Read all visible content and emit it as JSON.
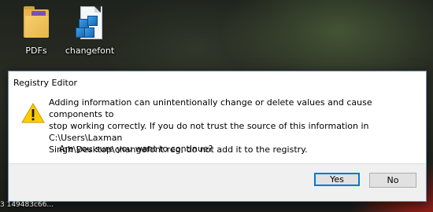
{
  "desktop": {
    "icons": [
      {
        "label": "PDFs",
        "icon": "folder-icon"
      },
      {
        "label": "changefont",
        "icon": "registry-file-icon"
      }
    ],
    "bottom_text": "3  149483c66..."
  },
  "dialog": {
    "title": "Registry Editor",
    "icon": "warning-icon",
    "accent_color": "#0078d7",
    "warning_color": "#ffcc00",
    "message": "Adding information can unintentionally change or delete values and cause components to\nstop working correctly. If you do not trust the source of this information in C:\\Users\\Laxman\nSingh\\Desktop\\changefont.reg, do not add it to the registry.",
    "question": "Are you sure you want to continue?",
    "buttons": {
      "yes": "Yes",
      "no": "No"
    }
  }
}
